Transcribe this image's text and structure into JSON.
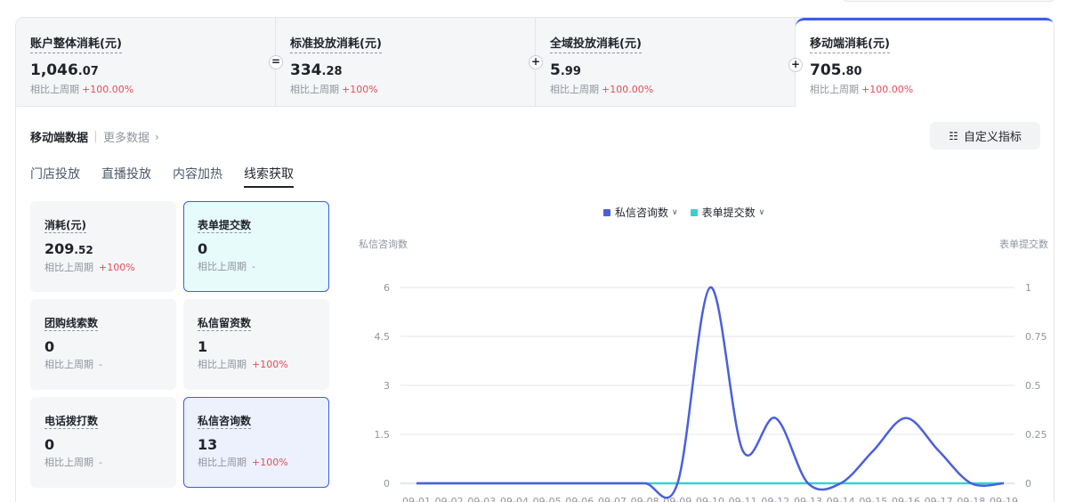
{
  "summary": [
    {
      "title": "账户整体消耗(元)",
      "int": "1,046",
      "dec": ".07",
      "compare_label": "相比上周期",
      "compare_value": "+100.00%",
      "op": ""
    },
    {
      "title": "标准投放消耗(元)",
      "int": "334",
      "dec": ".28",
      "compare_label": "相比上周期",
      "compare_value": "+100%",
      "op": "="
    },
    {
      "title": "全域投放消耗(元)",
      "int": "5",
      "dec": ".99",
      "compare_label": "相比上周期",
      "compare_value": "+100.00%",
      "op": "+"
    },
    {
      "title": "移动端消耗(元)",
      "int": "705",
      "dec": ".80",
      "compare_label": "相比上周期",
      "compare_value": "+100.00%",
      "op": "+"
    }
  ],
  "section": {
    "title": "移动端数据",
    "more": "更多数据",
    "custom_button": "自定义指标"
  },
  "tabs": [
    "门店投放",
    "直播投放",
    "内容加热",
    "线索获取"
  ],
  "active_tab": 3,
  "metrics": [
    {
      "title": "消耗(元)",
      "int": "209",
      "dec": ".52",
      "compare_label": "相比上周期",
      "compare_value": "+100%",
      "trend": "up",
      "state": "default"
    },
    {
      "title": "表单提交数",
      "int": "0",
      "dec": "",
      "compare_label": "相比上周期",
      "compare_value": "-",
      "trend": "none",
      "state": "selected-cyan"
    },
    {
      "title": "团购线索数",
      "int": "0",
      "dec": "",
      "compare_label": "相比上周期",
      "compare_value": "-",
      "trend": "none",
      "state": "default"
    },
    {
      "title": "私信留资数",
      "int": "1",
      "dec": "",
      "compare_label": "相比上周期",
      "compare_value": "+100%",
      "trend": "up",
      "state": "default"
    },
    {
      "title": "电话拨打数",
      "int": "0",
      "dec": "",
      "compare_label": "相比上周期",
      "compare_value": "-",
      "trend": "none",
      "state": "default"
    },
    {
      "title": "私信咨询数",
      "int": "13",
      "dec": "",
      "compare_label": "相比上周期",
      "compare_value": "+100%",
      "trend": "up",
      "state": "selected-blue"
    }
  ],
  "colors": {
    "accent": "#3b5cf0",
    "series1": "#4a5fdc",
    "series2": "#3ccfd0",
    "up": "#e34d59"
  },
  "chart_data": {
    "type": "line",
    "legend": [
      {
        "name": "私信咨询数",
        "color": "#4a5fdc"
      },
      {
        "name": "表单提交数",
        "color": "#3ccfd0"
      }
    ],
    "y_left_title": "私信咨询数",
    "y_right_title": "表单提交数",
    "y_left_ticks": [
      "0",
      "1.5",
      "3",
      "4.5",
      "6"
    ],
    "y_right_ticks": [
      "0",
      "0.25",
      "0.5",
      "0.75",
      "1"
    ],
    "y_left_range": [
      0,
      6
    ],
    "y_right_range": [
      0,
      1
    ],
    "x": [
      "09-01",
      "09-02",
      "09-03",
      "09-04",
      "09-05",
      "09-06",
      "09-07",
      "09-08",
      "09-09",
      "09-10",
      "09-11",
      "09-12",
      "09-13",
      "09-14",
      "09-15",
      "09-16",
      "09-17",
      "09-18",
      "09-19"
    ],
    "series": [
      {
        "name": "私信咨询数",
        "axis": "left",
        "values": [
          0,
          0,
          0,
          0,
          0,
          0,
          0,
          0,
          0,
          6,
          1,
          2,
          0,
          0,
          1,
          2,
          1,
          0,
          0
        ]
      },
      {
        "name": "表单提交数",
        "axis": "right",
        "values": [
          0,
          0,
          0,
          0,
          0,
          0,
          0,
          0,
          0,
          0,
          0,
          0,
          0,
          0,
          0,
          0,
          0,
          0,
          0
        ]
      }
    ],
    "grid": true,
    "legend_position": "top-center"
  }
}
